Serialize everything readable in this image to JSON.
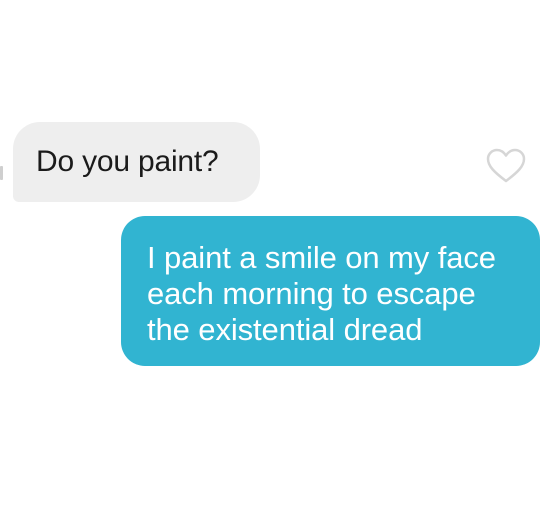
{
  "conversation": {
    "received": {
      "text": "Do you paint?"
    },
    "sent": {
      "lines": [
        "I paint a smile on my face",
        "each morning to escape",
        "the existential dread"
      ]
    },
    "like_icon": "heart-outline-icon"
  },
  "colors": {
    "received_bubble": "#eeeeee",
    "sent_bubble": "#31b4d1",
    "heart_outline": "#d6d6d6"
  }
}
